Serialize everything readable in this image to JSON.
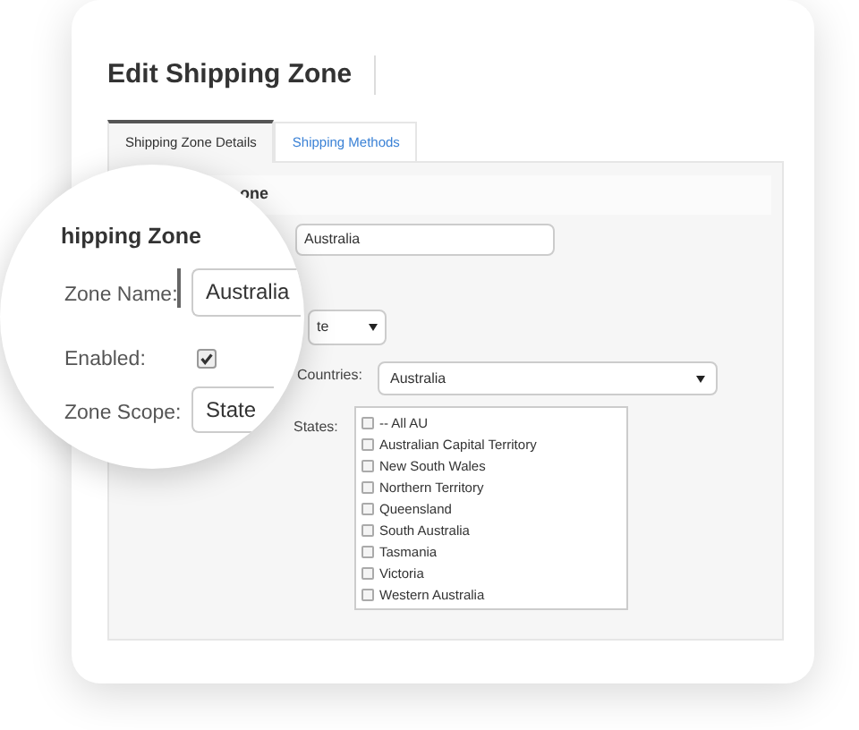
{
  "page_title": "Edit Shipping Zone",
  "tabs": [
    {
      "label": "Shipping Zone Details",
      "selected": true
    },
    {
      "label": "Shipping Methods",
      "selected": false
    }
  ],
  "form": {
    "section_heading": "one",
    "zone_name_value": "Australia",
    "zone_scope_value": "te",
    "countries": {
      "label": "Countries:",
      "value": "Australia"
    },
    "states": {
      "label": "States:",
      "options": [
        {
          "label": "-- All AU",
          "checked": false
        },
        {
          "label": "Australian Capital Territory",
          "checked": false
        },
        {
          "label": "New South Wales",
          "checked": false
        },
        {
          "label": "Northern Territory",
          "checked": false
        },
        {
          "label": "Queensland",
          "checked": false
        },
        {
          "label": "South Australia",
          "checked": false
        },
        {
          "label": "Tasmania",
          "checked": false
        },
        {
          "label": "Victoria",
          "checked": false
        },
        {
          "label": "Western Australia",
          "checked": false
        }
      ]
    }
  },
  "magnifier": {
    "heading": "hipping Zone",
    "fields": [
      {
        "kind": "text",
        "label": "Zone Name:",
        "value": "Australia"
      },
      {
        "kind": "checkbox",
        "label": "Enabled:",
        "checked": true
      },
      {
        "kind": "select",
        "label": "Zone Scope:",
        "value": "State"
      }
    ]
  }
}
